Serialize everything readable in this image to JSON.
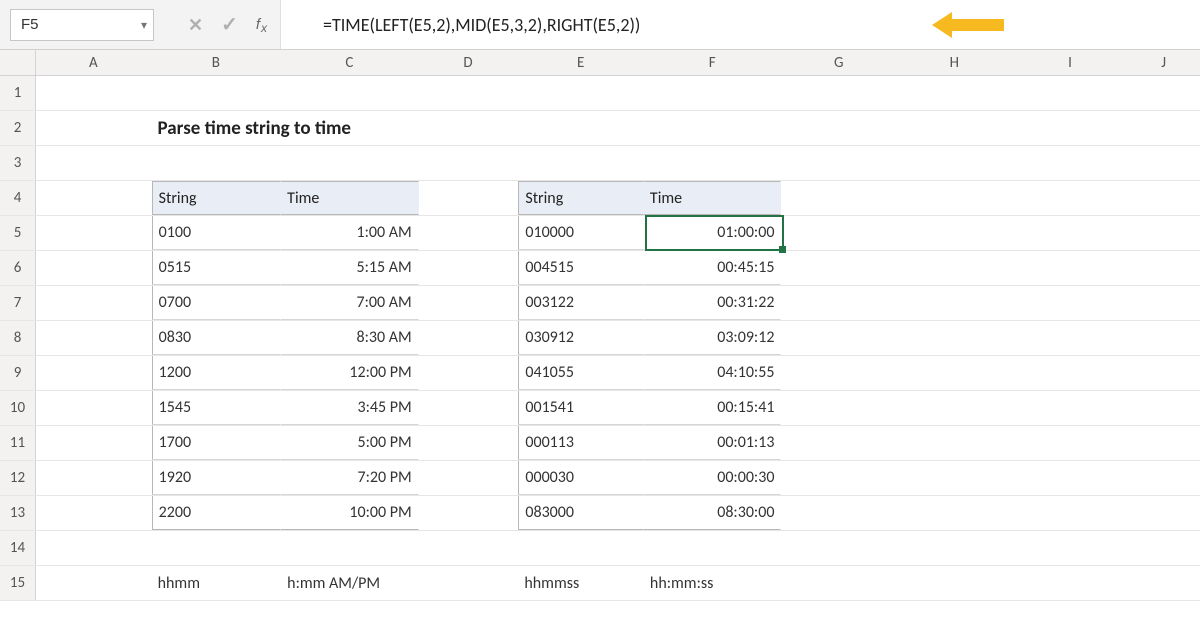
{
  "formula_bar": {
    "name_box": "F5",
    "formula": "=TIME(LEFT(E5,2),MID(E5,3,2),RIGHT(E5,2))"
  },
  "columns": [
    "A",
    "B",
    "C",
    "D",
    "E",
    "F",
    "G",
    "H",
    "I",
    "J"
  ],
  "rows_visible": [
    1,
    2,
    3,
    4,
    5,
    6,
    7,
    8,
    9,
    10,
    11,
    12,
    13,
    14,
    15
  ],
  "active_cell": {
    "ref": "F5",
    "row": 5,
    "col": "F"
  },
  "title": "Parse time string to time",
  "table1": {
    "headers": {
      "col1": "String",
      "col2": "Time"
    },
    "rows": [
      {
        "s": "0100",
        "t": "1:00 AM"
      },
      {
        "s": "0515",
        "t": "5:15 AM"
      },
      {
        "s": "0700",
        "t": "7:00 AM"
      },
      {
        "s": "0830",
        "t": "8:30 AM"
      },
      {
        "s": "1200",
        "t": "12:00 PM"
      },
      {
        "s": "1545",
        "t": "3:45 PM"
      },
      {
        "s": "1700",
        "t": "5:00 PM"
      },
      {
        "s": "1920",
        "t": "7:20 PM"
      },
      {
        "s": "2200",
        "t": "10:00 PM"
      }
    ],
    "footer": {
      "col1": "hhmm",
      "col2": "h:mm AM/PM"
    }
  },
  "table2": {
    "headers": {
      "col1": "String",
      "col2": "Time"
    },
    "rows": [
      {
        "s": "010000",
        "t": "01:00:00"
      },
      {
        "s": "004515",
        "t": "00:45:15"
      },
      {
        "s": "003122",
        "t": "00:31:22"
      },
      {
        "s": "030912",
        "t": "03:09:12"
      },
      {
        "s": "041055",
        "t": "04:10:55"
      },
      {
        "s": "001541",
        "t": "00:15:41"
      },
      {
        "s": "000113",
        "t": "00:01:13"
      },
      {
        "s": "000030",
        "t": "00:00:30"
      },
      {
        "s": "083000",
        "t": "08:30:00"
      }
    ],
    "footer": {
      "col1": "hhmmss",
      "col2": "hh:mm:ss"
    }
  }
}
